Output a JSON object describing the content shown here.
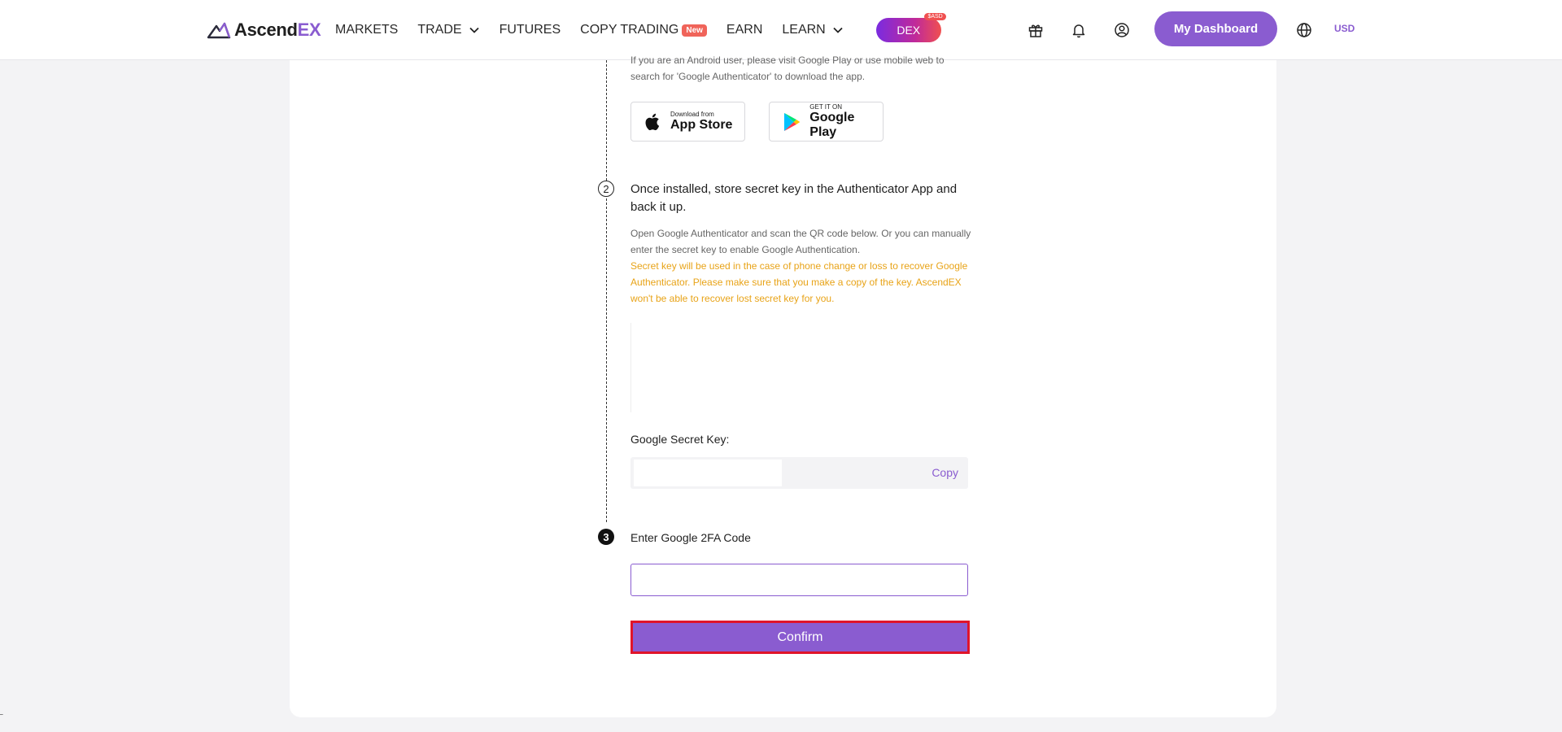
{
  "header": {
    "logo_main": "Ascend",
    "logo_accent": "EX",
    "nav": [
      {
        "label": "MARKETS",
        "has_chevron": false
      },
      {
        "label": "TRADE",
        "has_chevron": true
      },
      {
        "label": "FUTURES",
        "has_chevron": false
      },
      {
        "label": "COPY TRADING",
        "has_chevron": false,
        "badge": "New"
      },
      {
        "label": "EARN",
        "has_chevron": false
      },
      {
        "label": "LEARN",
        "has_chevron": true
      }
    ],
    "dex_label": "DEX",
    "dex_tag": "$ASD",
    "icons": [
      "gift-icon",
      "bell-icon",
      "account-icon"
    ],
    "dashboard_label": "My Dashboard",
    "language_icon": "globe-icon",
    "currency": "USD"
  },
  "step1": {
    "description": "If you are an Android user, please visit Google Play or use mobile web to search for 'Google Authenticator' to download the app.",
    "app_store": {
      "small": "Download from",
      "big": "App Store"
    },
    "google_play": {
      "small": "GET IT ON",
      "big": "Google Play"
    }
  },
  "step2": {
    "number": "2",
    "title": "Once installed, store secret key in the Authenticator App and back it up.",
    "description": "Open Google Authenticator and scan the QR code below. Or you can manually enter the secret key to enable Google Authentication.",
    "warning": "Secret key will be used in the case of phone change or loss to recover Google Authenticator. Please make sure that you make a copy of the key. AscendEX won't be able to recover lost secret key for you.",
    "secret_label": "Google Secret Key:",
    "copy_label": "Copy"
  },
  "step3": {
    "number": "3",
    "title": "Enter Google 2FA Code",
    "input_value": "",
    "input_placeholder": "",
    "confirm_label": "Confirm"
  },
  "colors": {
    "accent": "#8a5cd0",
    "warning": "#e8a317",
    "highlight_border": "#e0142a"
  }
}
